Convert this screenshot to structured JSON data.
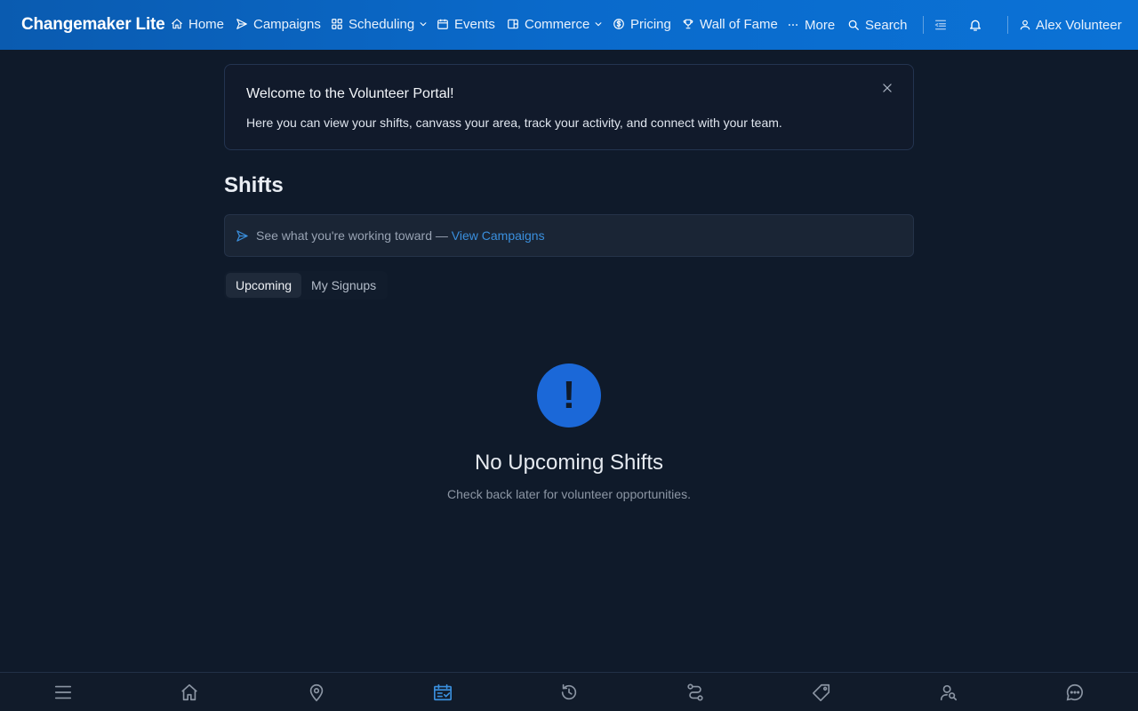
{
  "app": {
    "brand": "Changemaker Lite"
  },
  "nav": {
    "items": [
      {
        "label": "Home",
        "icon": "home-icon"
      },
      {
        "label": "Campaigns",
        "icon": "send-icon"
      },
      {
        "label": "Scheduling",
        "icon": "grid-icon",
        "dropdown": true
      },
      {
        "label": "Events",
        "icon": "calendar-icon"
      },
      {
        "label": "Commerce",
        "icon": "store-icon",
        "dropdown": true
      },
      {
        "label": "Pricing",
        "icon": "dollar-icon"
      },
      {
        "label": "Wall of Fame",
        "icon": "trophy-icon"
      },
      {
        "label": "More",
        "icon": "ellipsis-icon"
      },
      {
        "label": "Search",
        "icon": "search-icon"
      }
    ],
    "user": "Alex Volunteer"
  },
  "welcome": {
    "title": "Welcome to the Volunteer Portal!",
    "text": "Here you can view your shifts, canvass your area, track your activity, and connect with your team."
  },
  "page": {
    "title": "Shifts"
  },
  "campaign_strip": {
    "text": "See what you're working toward — ",
    "link": "View Campaigns"
  },
  "tabs": [
    {
      "label": "Upcoming",
      "active": true
    },
    {
      "label": "My Signups",
      "active": false
    }
  ],
  "empty_state": {
    "symbol": "!",
    "title": "No Upcoming Shifts",
    "subtitle": "Check back later for volunteer opportunities."
  },
  "bottom_nav": [
    {
      "icon": "menu-icon"
    },
    {
      "icon": "home-icon"
    },
    {
      "icon": "map-pin-icon"
    },
    {
      "icon": "calendar-check-icon",
      "active": true
    },
    {
      "icon": "history-icon"
    },
    {
      "icon": "route-icon"
    },
    {
      "icon": "tag-icon"
    },
    {
      "icon": "user-search-icon"
    },
    {
      "icon": "chat-icon"
    }
  ],
  "colors": {
    "topbar": "#0a6acb",
    "background": "#0f1a2a",
    "accent": "#1b68d8",
    "link": "#3a8fdd"
  }
}
